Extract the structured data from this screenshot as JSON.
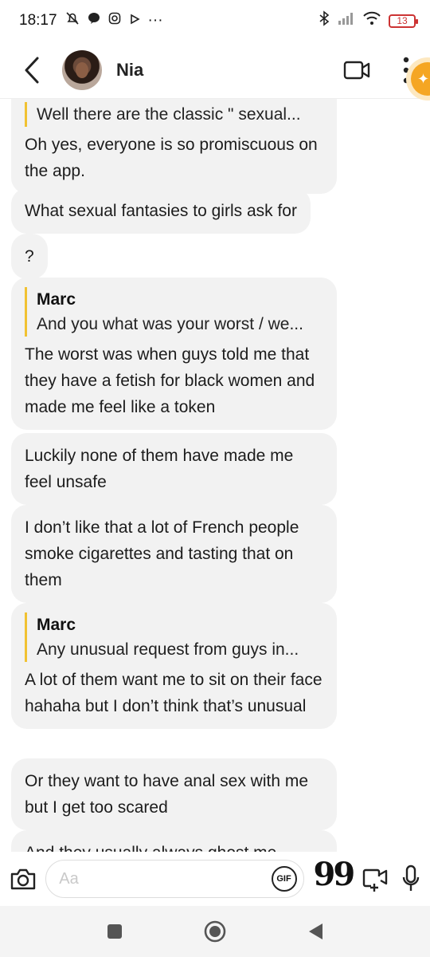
{
  "status_bar": {
    "time": "18:17",
    "more": "···",
    "battery": "13"
  },
  "header": {
    "contact_name": "Nia"
  },
  "messages": [
    {
      "quote_text": "Well there are the classic \" sexual...",
      "text": "Oh yes, everyone is so promiscuous on the app."
    },
    {
      "text": "What sexual fantasies to girls ask for"
    },
    {
      "text": "?"
    },
    {
      "quote_name": "Marc",
      "quote_text": "And you what was your worst / we...",
      "text": "The worst was when guys told me that they have a fetish for black women and made me feel like a token"
    },
    {
      "text": "Luckily none of them have made me feel unsafe"
    },
    {
      "text": "I don’t like that a lot of French people smoke cigarettes and tasting that on them"
    },
    {
      "quote_name": "Marc",
      "quote_text": "Any unusual request from guys in...",
      "text": "A lot of them want me to sit on their face hahaha but I don’t think that’s unusual"
    },
    {
      "text": "Or they want to have anal sex with me but I get too scared"
    },
    {
      "text": "And they usually always ghost me"
    }
  ],
  "composer": {
    "placeholder": "Aa",
    "gif_label": "GIF",
    "quote_label": "99"
  },
  "colors": {
    "bubble_bg": "#f2f2f2",
    "quote_bar": "#f1c232",
    "badge": "#f5a623",
    "battery": "#cc3333"
  },
  "icons": [
    "chevron-left-icon",
    "video-camera-icon",
    "more-vertical-icon",
    "camera-icon",
    "video-message-icon",
    "microphone-icon",
    "square-icon",
    "circle-home-icon",
    "triangle-back-icon"
  ]
}
